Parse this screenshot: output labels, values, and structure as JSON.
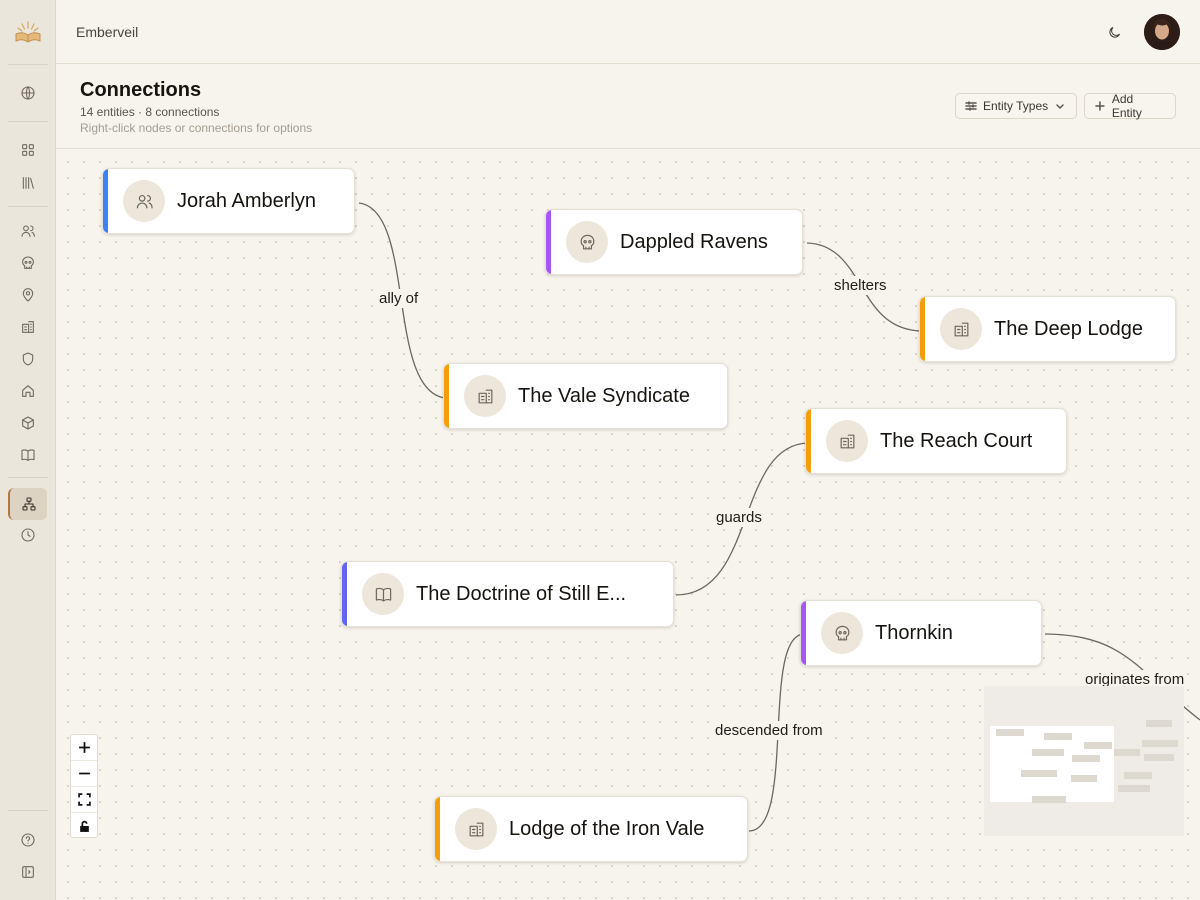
{
  "app": {
    "name": "Emberveil"
  },
  "colors": {
    "accent": "#b07a3f",
    "character": "#3b82f6",
    "faction": "#a855f7",
    "organization": "#f59e0b",
    "lore": "#6366f1"
  },
  "sidebar": {
    "items": [
      {
        "icon": "globe-icon"
      },
      {
        "icon": "dashboard-icon"
      },
      {
        "icon": "library-icon"
      },
      {
        "icon": "users-icon"
      },
      {
        "icon": "skull-icon"
      },
      {
        "icon": "map-pin-icon"
      },
      {
        "icon": "building-icon"
      },
      {
        "icon": "shield-icon"
      },
      {
        "icon": "home-icon"
      },
      {
        "icon": "box-icon"
      },
      {
        "icon": "book-icon"
      },
      {
        "icon": "network-icon",
        "active": true
      },
      {
        "icon": "clock-icon"
      },
      {
        "icon": "help-icon"
      },
      {
        "icon": "panel-toggle-icon"
      }
    ]
  },
  "header": {
    "title": "Connections",
    "subtitle": "14 entities · 8 connections",
    "hint": "Right-click nodes or connections for options",
    "entity_types_label": "Entity Types",
    "add_entity_label": "Add Entity"
  },
  "nodes": [
    {
      "id": "jorah",
      "label": "Jorah Amberlyn",
      "type": "character",
      "icon": "users-icon"
    },
    {
      "id": "ravens",
      "label": "Dappled Ravens",
      "type": "faction",
      "icon": "skull-icon"
    },
    {
      "id": "deep",
      "label": "The Deep Lodge",
      "type": "organization",
      "icon": "building-icon"
    },
    {
      "id": "vale",
      "label": "The Vale Syndicate",
      "type": "organization",
      "icon": "building-icon"
    },
    {
      "id": "reach",
      "label": "The Reach Court",
      "type": "organization",
      "icon": "building-icon"
    },
    {
      "id": "doctrine",
      "label": "The Doctrine of Still E...",
      "type": "lore",
      "icon": "book-icon"
    },
    {
      "id": "thornkin",
      "label": "Thornkin",
      "type": "faction",
      "icon": "skull-icon"
    },
    {
      "id": "iron",
      "label": "Lodge of the Iron Vale",
      "type": "organization",
      "icon": "building-icon"
    }
  ],
  "edges": [
    {
      "from": "jorah",
      "to": "vale",
      "label": "ally of"
    },
    {
      "from": "ravens",
      "to": "deep",
      "label": "shelters"
    },
    {
      "from": "doctrine",
      "to": "reach",
      "label": "guards"
    },
    {
      "from": "iron",
      "to": "thornkin",
      "label": "descended from"
    },
    {
      "from": "thornkin",
      "to": "offscreen",
      "label": "originates from"
    }
  ],
  "controls": {
    "zoom_in": "plus-icon",
    "zoom_out": "minus-icon",
    "fit_view": "fit-view-icon",
    "lock": "lock-icon"
  }
}
